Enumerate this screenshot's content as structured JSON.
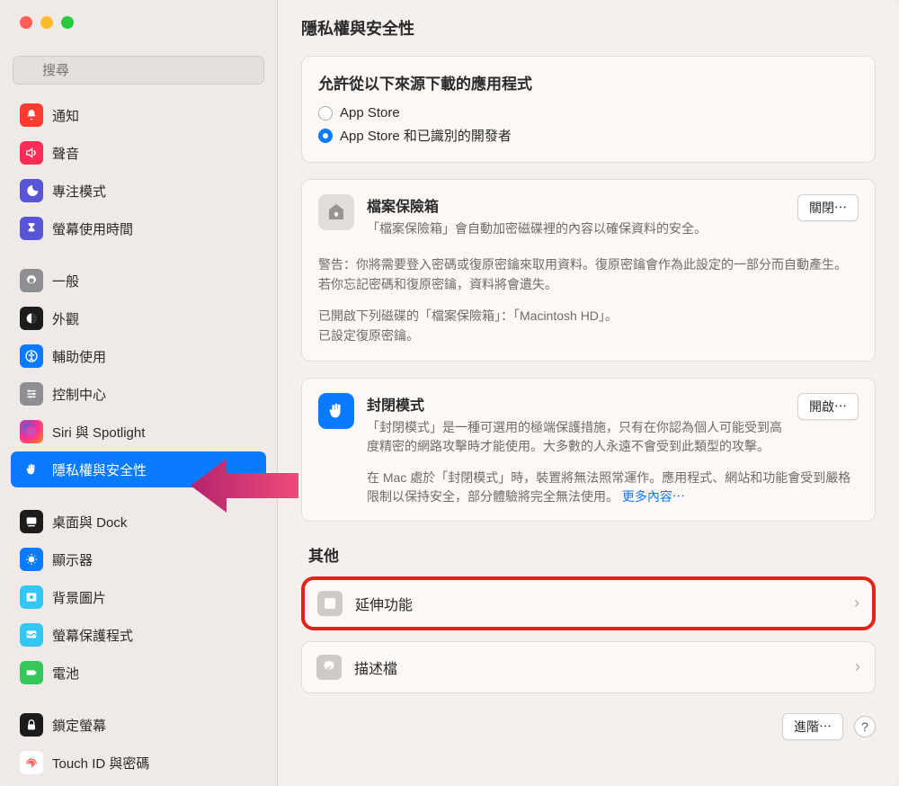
{
  "search": {
    "placeholder": "搜尋"
  },
  "sidebar": {
    "items": [
      {
        "label": "通知",
        "icon_bg": "#ff3b30",
        "icon_name": "bell-icon"
      },
      {
        "label": "聲音",
        "icon_bg": "#ff2d55",
        "icon_name": "speaker-icon"
      },
      {
        "label": "專注模式",
        "icon_bg": "#5856d6",
        "icon_name": "moon-icon"
      },
      {
        "label": "螢幕使用時間",
        "icon_bg": "#5856d6",
        "icon_name": "hourglass-icon"
      },
      {
        "sep": true
      },
      {
        "label": "一般",
        "icon_bg": "#8e8e93",
        "icon_name": "gear-icon"
      },
      {
        "label": "外觀",
        "icon_bg": "#1c1c1e",
        "icon_name": "appearance-icon"
      },
      {
        "label": "輔助使用",
        "icon_bg": "#0a7aff",
        "icon_name": "accessibility-icon"
      },
      {
        "label": "控制中心",
        "icon_bg": "#8e8e93",
        "icon_name": "sliders-icon"
      },
      {
        "label": "Siri 與 Spotlight",
        "icon_bg": "#1c1c1e",
        "icon_name": "siri-icon",
        "gradient": true
      },
      {
        "label": "隱私權與安全性",
        "icon_bg": "#0a7aff",
        "icon_name": "hand-icon",
        "selected": true
      },
      {
        "sep": true
      },
      {
        "label": "桌面與 Dock",
        "icon_bg": "#1c1c1e",
        "icon_name": "dock-icon"
      },
      {
        "label": "顯示器",
        "icon_bg": "#0a7aff",
        "icon_name": "display-icon"
      },
      {
        "label": "背景圖片",
        "icon_bg": "#34c7f5",
        "icon_name": "wallpaper-icon"
      },
      {
        "label": "螢幕保護程式",
        "icon_bg": "#34c7f5",
        "icon_name": "screensaver-icon"
      },
      {
        "label": "電池",
        "icon_bg": "#34c759",
        "icon_name": "battery-icon"
      },
      {
        "sep": true
      },
      {
        "label": "鎖定螢幕",
        "icon_bg": "#1c1c1e",
        "icon_name": "lock-icon"
      },
      {
        "label": "Touch ID 與密碼",
        "icon_bg": "#ffffff",
        "icon_name": "fingerprint-icon",
        "fg": "#ff3b30"
      }
    ]
  },
  "page": {
    "title": "隱私權與安全性"
  },
  "allow_apps": {
    "title": "允許從以下來源下載的應用程式",
    "opt1": "App Store",
    "opt2": "App Store 和已識別的開發者"
  },
  "filevault": {
    "title": "檔案保險箱",
    "desc": "「檔案保險箱」會自動加密磁碟裡的內容以確保資料的安全。",
    "warn": "警告：你將需要登入密碼或復原密鑰來取用資料。復原密鑰會作為此設定的一部分而自動產生。若你忘記密碼和復原密鑰，資料將會遺失。",
    "status1": "已開啟下列磁碟的「檔案保險箱」：「Macintosh HD」。",
    "status2": "已設定復原密鑰。",
    "action": "關閉⋯"
  },
  "lockdown": {
    "title": "封閉模式",
    "desc": "「封閉模式」是一種可選用的極端保護措施，只有在你認為個人可能受到高度精密的網路攻擊時才能使用。大多數的人永遠不會受到此類型的攻擊。",
    "note": "在 Mac 處於「封閉模式」時，裝置將無法照常運作。應用程式、網站和功能會受到嚴格限制以保持安全，部分體驗將完全無法使用。",
    "more": "更多內容⋯",
    "action": "開啟⋯"
  },
  "other": {
    "title": "其他",
    "extensions": "延伸功能",
    "profiles": "描述檔"
  },
  "footer": {
    "advanced": "進階⋯",
    "help": "?"
  }
}
